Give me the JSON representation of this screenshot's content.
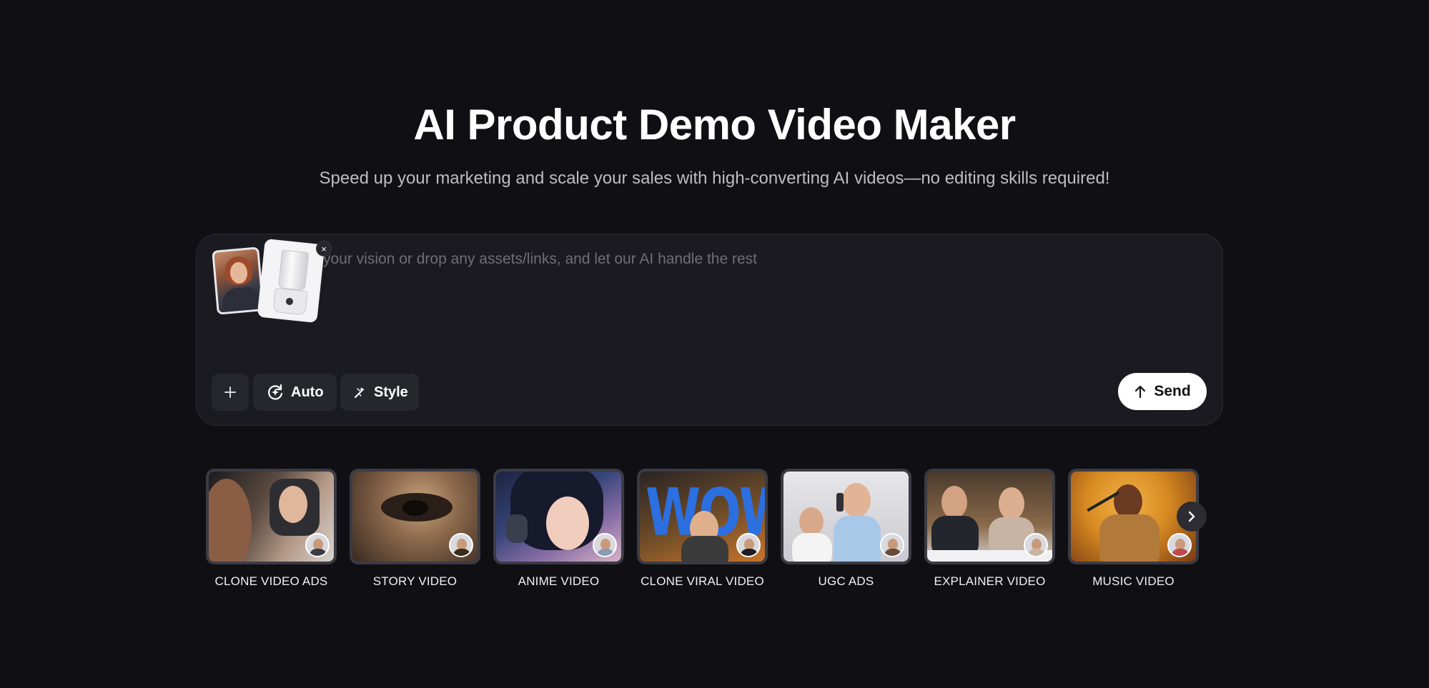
{
  "hero": {
    "title": "AI Product Demo Video Maker",
    "subtitle": "Speed up your marketing and scale your sales with high-converting AI videos—no editing skills required!"
  },
  "prompt": {
    "placeholder": "your vision or drop any assets/links, and let our AI handle the rest",
    "assets": [
      "woman-portrait-thumbnail",
      "blender-product-thumbnail"
    ],
    "remove_icon": "×"
  },
  "toolbar": {
    "plus_icon": "plus-icon",
    "auto_label": "Auto",
    "style_label": "Style",
    "send_label": "Send"
  },
  "categories": [
    {
      "label": "CLONE VIDEO ADS"
    },
    {
      "label": "STORY VIDEO"
    },
    {
      "label": "ANIME VIDEO"
    },
    {
      "label": "CLONE VIRAL VIDEO"
    },
    {
      "label": "UGC ADS"
    },
    {
      "label": "EXPLAINER VIDEO"
    },
    {
      "label": "MUSIC VIDEO"
    }
  ],
  "wow_text": "WOW",
  "colors": {
    "background": "#0f0f14",
    "panel": "#1a1a20",
    "button": "#26262d",
    "send_bg": "#ffffff",
    "wow_blue": "#2b6fe0"
  }
}
